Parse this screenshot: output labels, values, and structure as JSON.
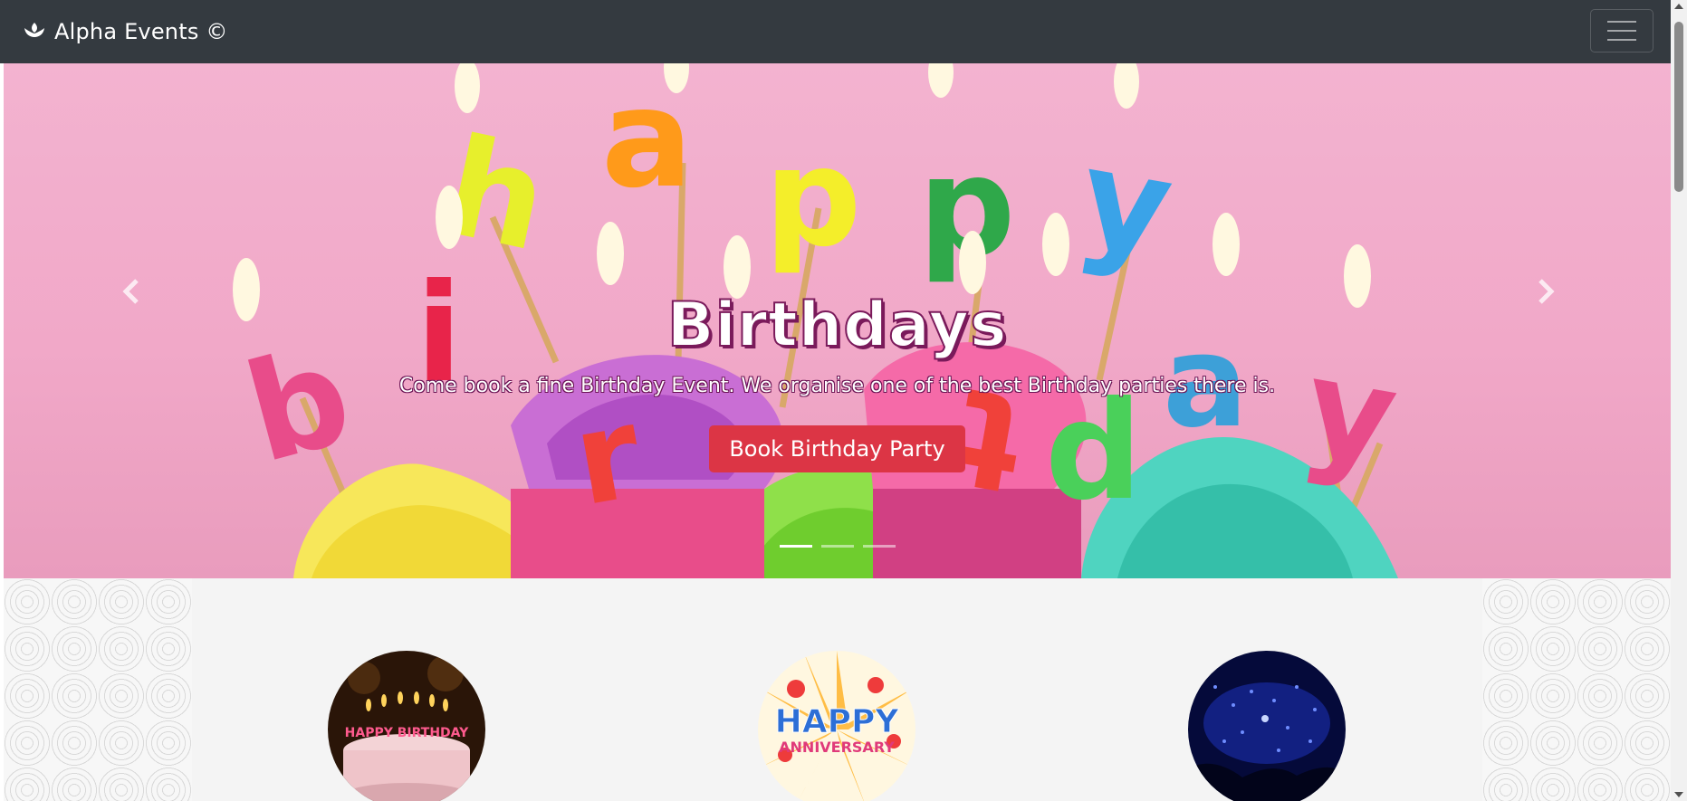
{
  "navbar": {
    "brand": "Alpha Events ©",
    "toggler_icon": "hamburger-icon"
  },
  "carousel": {
    "slide_title": "Birthdays",
    "slide_text": "Come book a fine Birthday Event. We organise one of the best Birthday parties there is.",
    "button_label": "Book Birthday Party",
    "prev_icon": "chevron-left-icon",
    "next_icon": "chevron-right-icon",
    "indicators": 3,
    "active_indicator": 1
  },
  "thumbnails": {
    "birthday_cake_text": "HAPPY BIRTHDAY",
    "anniversary_line1": "HAPPY",
    "anniversary_line2": "ANNIVERSARY"
  },
  "colors": {
    "navbar": "#343a40",
    "button": "#dc3545",
    "slide_background": "#f1a8c8"
  }
}
